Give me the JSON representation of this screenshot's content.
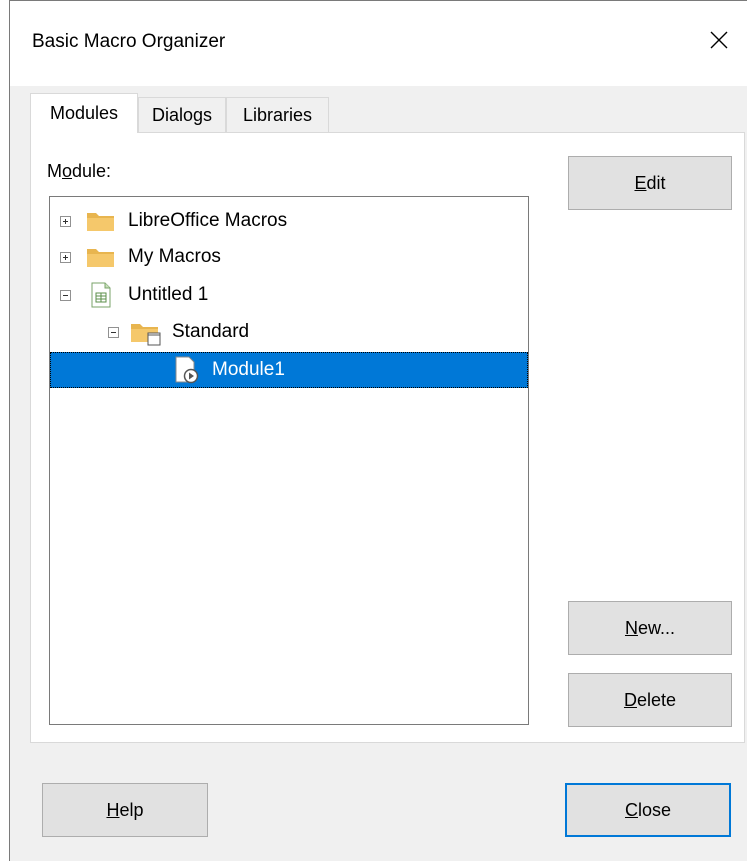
{
  "window": {
    "title": "Basic Macro Organizer"
  },
  "tabs": [
    {
      "label": "Modules",
      "active": true
    },
    {
      "label": "Dialogs",
      "active": false
    },
    {
      "label": "Libraries",
      "active": false
    }
  ],
  "modules_panel": {
    "label_pre": "M",
    "label_key": "o",
    "label_post": "dule:",
    "tree": [
      {
        "label": "LibreOffice Macros",
        "expanded": false,
        "level": 0,
        "icon": "folder-icon"
      },
      {
        "label": "My Macros",
        "expanded": false,
        "level": 0,
        "icon": "folder-icon"
      },
      {
        "label": "Untitled 1",
        "expanded": true,
        "level": 0,
        "icon": "spreadsheet-document-icon"
      },
      {
        "label": "Standard",
        "expanded": true,
        "level": 1,
        "icon": "library-folder-icon"
      },
      {
        "label": "Module1",
        "level": 2,
        "icon": "basic-module-icon",
        "selected": true
      }
    ],
    "buttons": {
      "edit_key": "E",
      "edit_rest": "dit",
      "new_key": "N",
      "new_rest": "ew...",
      "delete_key": "D",
      "delete_rest": "elete"
    }
  },
  "footer": {
    "help_key": "H",
    "help_rest": "elp",
    "close_key": "C",
    "close_rest": "lose"
  },
  "colors": {
    "selection": "#0078d7",
    "folder": "#f5c86b"
  }
}
